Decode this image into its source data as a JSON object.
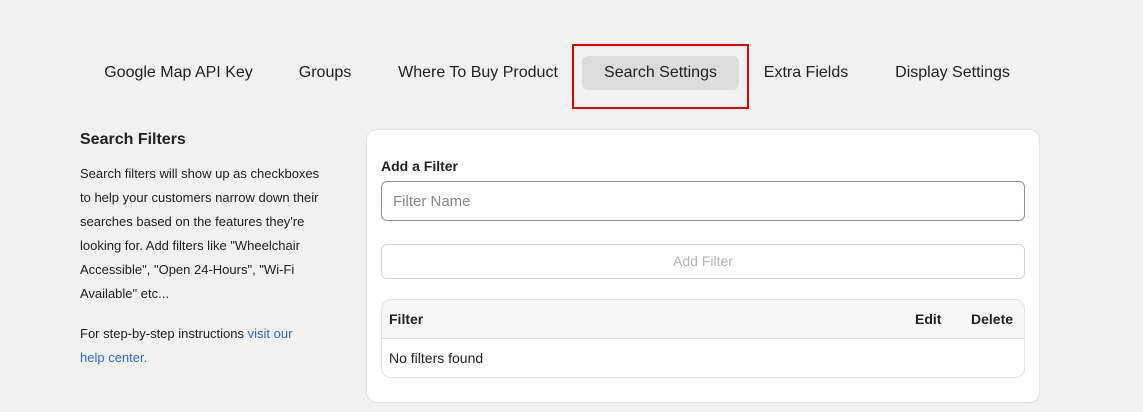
{
  "tabs": [
    {
      "label": "Google Map API Key"
    },
    {
      "label": "Groups"
    },
    {
      "label": "Where To Buy Product"
    },
    {
      "label": "Search Settings",
      "active": true
    },
    {
      "label": "Extra Fields"
    },
    {
      "label": "Display Settings"
    }
  ],
  "sidebar": {
    "title": "Search Filters",
    "description": "Search filters will show up as checkboxes to help your customers narrow down their searches based on the features they're looking for. Add filters like \"Wheelchair Accessible\", \"Open 24-Hours\", \"Wi-Fi Available\" etc...",
    "help_prefix": "For step-by-step instructions ",
    "help_link": "visit our help center."
  },
  "form": {
    "label": "Add a Filter",
    "placeholder": "Filter Name",
    "value": "",
    "add_button": "Add Filter"
  },
  "table": {
    "headers": {
      "filter": "Filter",
      "edit": "Edit",
      "delete": "Delete"
    },
    "empty_message": "No filters found"
  },
  "colors": {
    "highlight": "#e00000",
    "link": "#2c6ecb",
    "active_tab": "#dcdcdc"
  }
}
